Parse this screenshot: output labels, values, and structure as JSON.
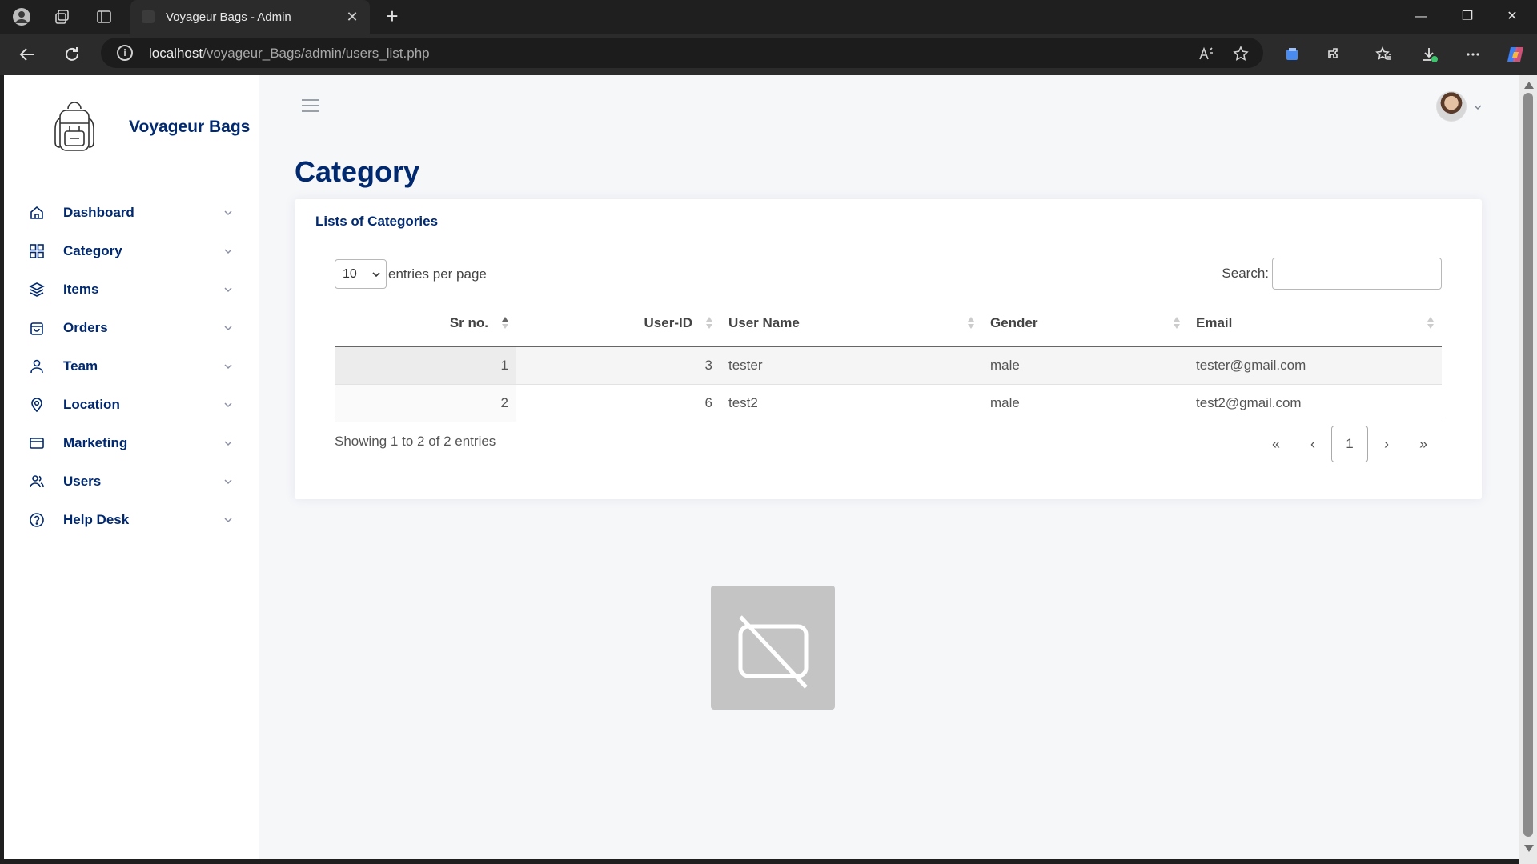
{
  "browser": {
    "tab_title": "Voyageur Bags - Admin",
    "url_host": "localhost",
    "url_path": "/voyageur_Bags/admin/users_list.php"
  },
  "sidebar": {
    "brand": "Voyageur Bags",
    "items": [
      {
        "label": "Dashboard",
        "icon": "house-icon"
      },
      {
        "label": "Category",
        "icon": "grid-icon"
      },
      {
        "label": "Items",
        "icon": "layers-icon"
      },
      {
        "label": "Orders",
        "icon": "bag-icon"
      },
      {
        "label": "Team",
        "icon": "person-icon"
      },
      {
        "label": "Location",
        "icon": "geo-pin-icon"
      },
      {
        "label": "Marketing",
        "icon": "credit-card-icon"
      },
      {
        "label": "Users",
        "icon": "people-icon"
      },
      {
        "label": "Help Desk",
        "icon": "question-circle-icon"
      }
    ]
  },
  "main": {
    "page_title": "Category",
    "card_title": "Lists of Categories",
    "entries_value": "10",
    "entries_label": "entries per page",
    "search_label": "Search:",
    "search_value": "",
    "columns": [
      "Sr no.",
      "User-ID",
      "User Name",
      "Gender",
      "Email"
    ],
    "rows": [
      [
        "1",
        "3",
        "tester",
        "male",
        "tester@gmail.com"
      ],
      [
        "2",
        "6",
        "test2",
        "male",
        "test2@gmail.com"
      ]
    ],
    "info": "Showing 1 to 2 of 2 entries",
    "pagination": {
      "first": "«",
      "prev": "‹",
      "current": "1",
      "next": "›",
      "last": "»"
    }
  },
  "colors": {
    "brand_navy": "#012970",
    "page_bg": "#f6f7f9"
  }
}
